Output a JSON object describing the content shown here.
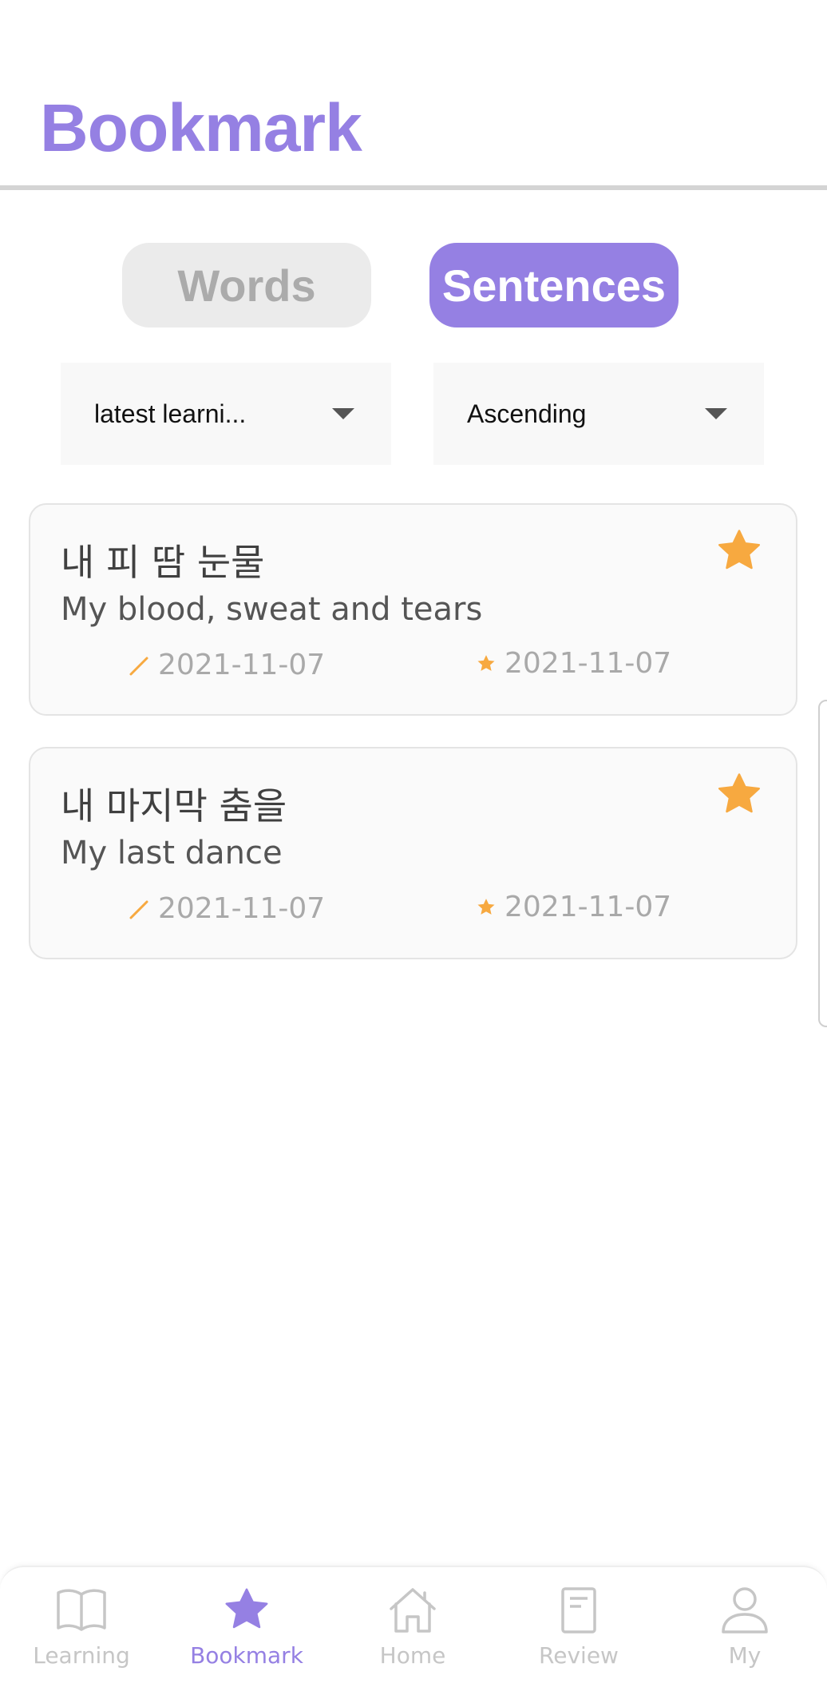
{
  "header": {
    "title": "Bookmark"
  },
  "tabs": [
    {
      "label": "Words",
      "active": false
    },
    {
      "label": "Sentences",
      "active": true
    }
  ],
  "filters": {
    "sort": {
      "selected": "latest learni..."
    },
    "order": {
      "selected": "Ascending"
    }
  },
  "cards": [
    {
      "korean": "내 피 땀 눈물",
      "english": "My blood, sweat and tears",
      "learned_date": "2021-11-07",
      "bookmarked_date": "2021-11-07",
      "icons": [
        "pencil-icon",
        "star-icon"
      ]
    },
    {
      "korean": "내 마지막 춤을",
      "english": "My last dance",
      "learned_date": "2021-11-07",
      "bookmarked_date": "2021-11-07",
      "icons": [
        "pencil-icon",
        "star-icon"
      ]
    }
  ],
  "bottom_nav": [
    {
      "label": "Learning",
      "icon": "book-icon",
      "active": false
    },
    {
      "label": "Bookmark",
      "icon": "star-icon",
      "active": true
    },
    {
      "label": "Home",
      "icon": "home-icon",
      "active": false
    },
    {
      "label": "Review",
      "icon": "document-icon",
      "active": false
    },
    {
      "label": "My",
      "icon": "person-icon",
      "active": false
    }
  ],
  "colors": {
    "accent": "#9580e3",
    "star": "#f7a940",
    "inactive": "#c6c6c6"
  }
}
